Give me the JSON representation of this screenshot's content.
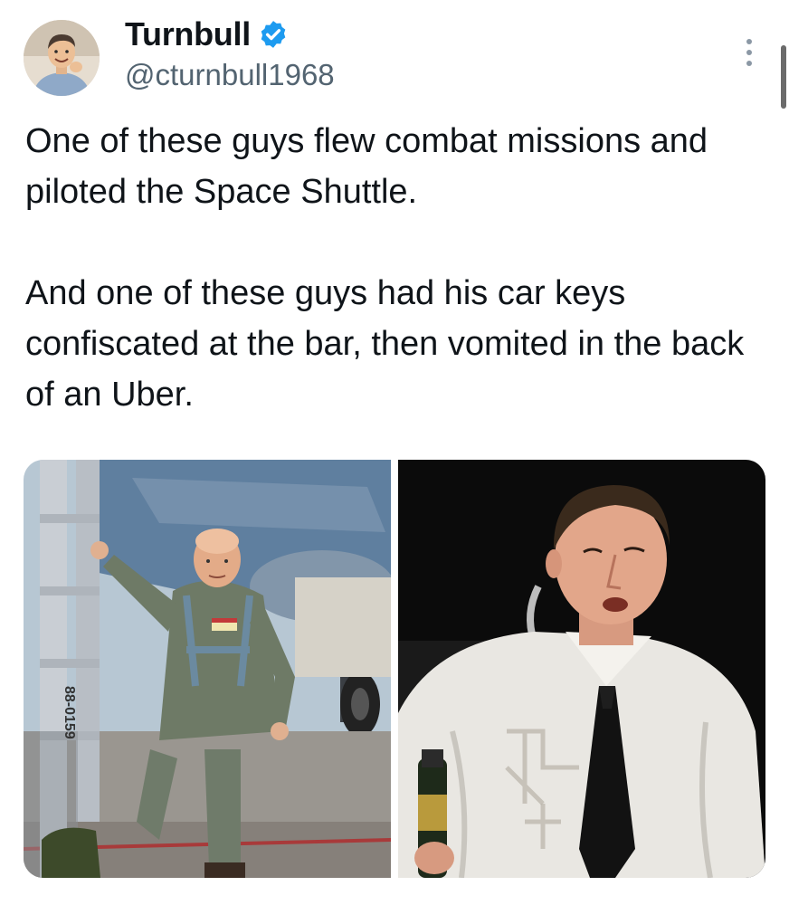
{
  "author": {
    "display_name": "Turnbull",
    "handle": "@cturnbull1968",
    "verified": true,
    "avatar_icon": "cartoon-avatar-icon"
  },
  "tweet": {
    "paragraphs": [
      "One of these guys flew combat missions and piloted the Space Shuttle.",
      "And one of these guys had his car keys confiscated at the bar, then vomited in the back of an Uber."
    ]
  },
  "media": {
    "left_photo_marking": "88-0159",
    "colors": {
      "verified_badge": "#1d9bf0",
      "handle": "#536471",
      "text": "#0f1419"
    }
  },
  "menu": {
    "more_icon": "more-vertical-icon"
  }
}
